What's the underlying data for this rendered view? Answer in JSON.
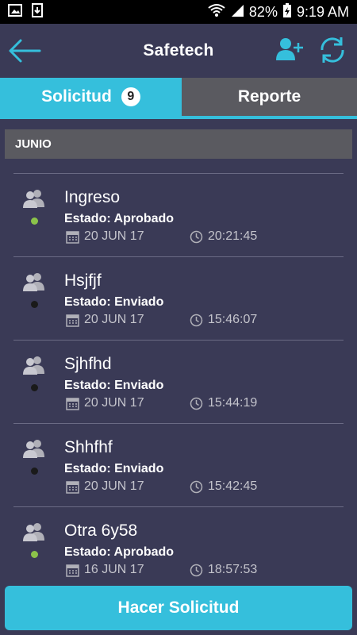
{
  "status_bar": {
    "battery": "82%",
    "time": "9:19 AM"
  },
  "app_bar": {
    "title": "Safetech"
  },
  "tabs": [
    {
      "label": "Solicitud",
      "badge": "9",
      "active": true
    },
    {
      "label": "Reporte",
      "active": false
    }
  ],
  "section": {
    "label": "JUNIO"
  },
  "colors": {
    "accent": "#35bfdc",
    "approved": "#8bc34a",
    "sent": "#1a1a1a",
    "background": "#3a3a56"
  },
  "items": [
    {
      "title": "Ingreso",
      "estado": "Estado: Aprobado",
      "status": "approved",
      "date": "20 JUN 17",
      "time": "20:21:45"
    },
    {
      "title": "Hsjfjf",
      "estado": "Estado: Enviado",
      "status": "sent",
      "date": "20 JUN 17",
      "time": "15:46:07"
    },
    {
      "title": "Sjhfhd",
      "estado": "Estado: Enviado",
      "status": "sent",
      "date": "20 JUN 17",
      "time": "15:44:19"
    },
    {
      "title": "Shhfhf",
      "estado": "Estado: Enviado",
      "status": "sent",
      "date": "20 JUN 17",
      "time": "15:42:45"
    },
    {
      "title": "Otra 6y58",
      "estado": "Estado: Aprobado",
      "status": "approved",
      "date": "16 JUN 17",
      "time": "18:57:53"
    }
  ],
  "cta": {
    "label": "Hacer Solicitud"
  }
}
